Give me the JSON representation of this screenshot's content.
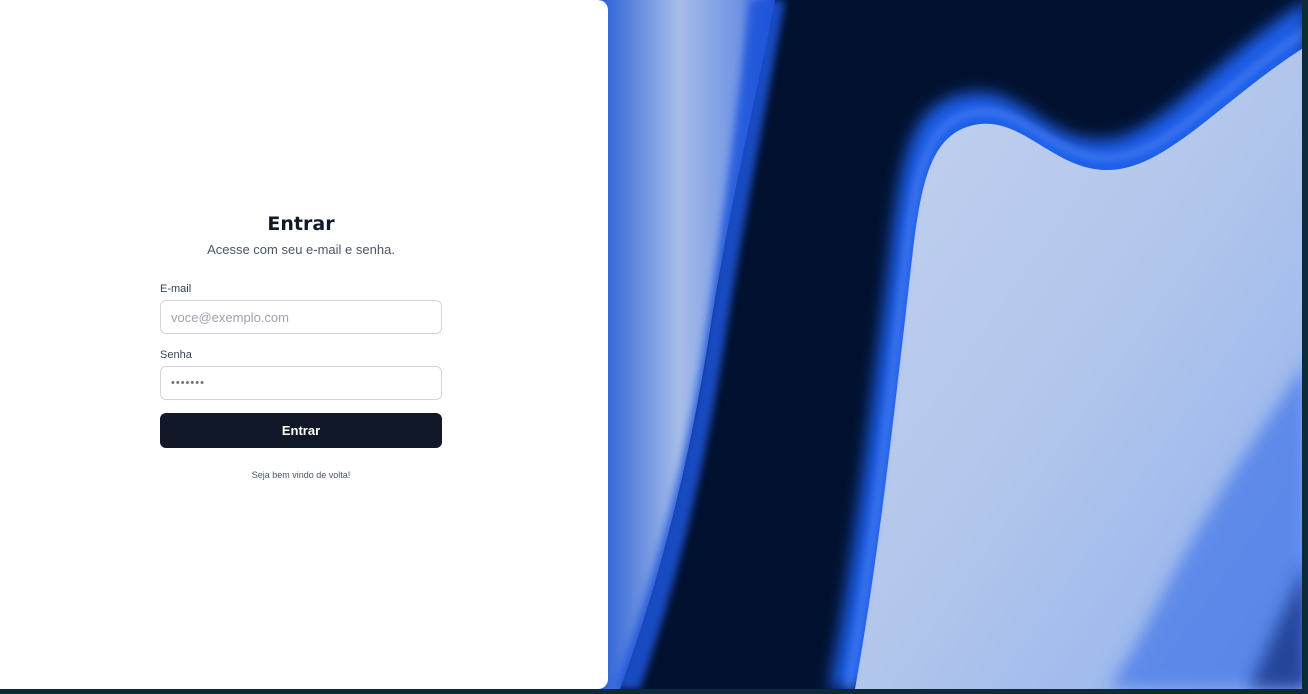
{
  "login": {
    "title": "Entrar",
    "subtitle": "Acesse com seu e-mail e senha.",
    "email": {
      "label": "E-mail",
      "placeholder": "voce@exemplo.com",
      "value": ""
    },
    "password": {
      "label": "Senha",
      "masked_value": "•••••••"
    },
    "submit_label": "Entrar",
    "footnote": "Seja bem vindo de volta!"
  },
  "colors": {
    "panel_background": "#ffffff",
    "button_background": "#111827",
    "hero_dark": "#02112f",
    "hero_blue": "#1e5ee8",
    "hero_light": "#b6c9ec"
  }
}
